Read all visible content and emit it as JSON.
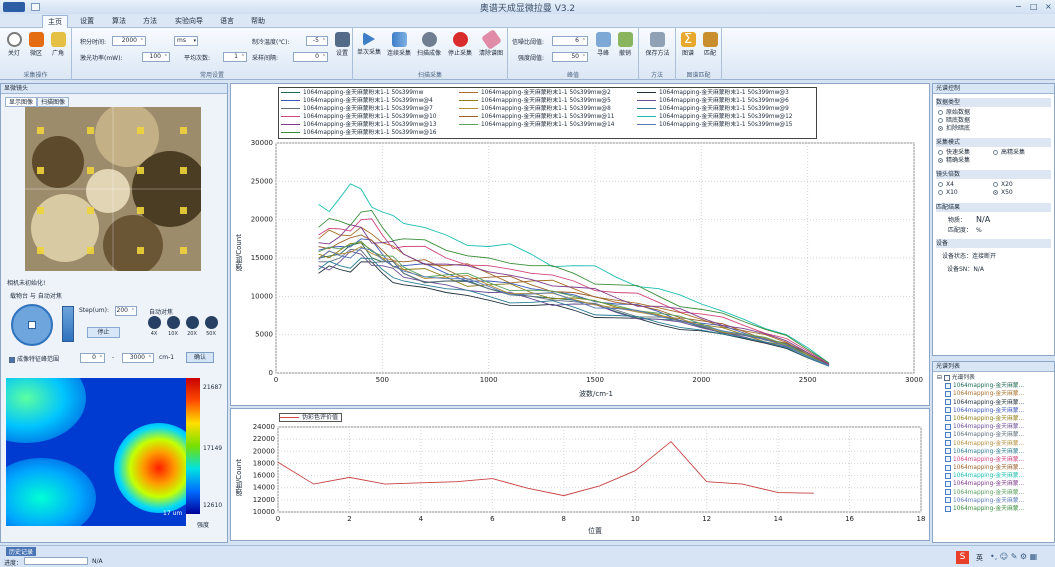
{
  "app": {
    "title": "奥谱天成显微拉曼 V3.2",
    "menu": [
      "主页",
      "设置",
      "算法",
      "方法",
      "实验向导",
      "语言",
      "帮助"
    ],
    "active_menu": "主页",
    "window_controls": [
      "−",
      "□",
      "×"
    ]
  },
  "ribbon": {
    "collect_group": {
      "title": "采集操作",
      "buttons": [
        "关灯",
        "微区",
        "广角"
      ]
    },
    "settings_group": {
      "title": "常用设置",
      "fields": [
        {
          "label": "积分时间:",
          "value": "2000",
          "unit": "ms"
        },
        {
          "label": "激光功率(mW):",
          "value": "100"
        },
        {
          "label": "平均次数:",
          "value": "1"
        },
        {
          "label": "制冷温度(℃):",
          "value": "-5"
        },
        {
          "label": "采样间隔:",
          "value": "0"
        }
      ],
      "button": "设置"
    },
    "scan_group": {
      "title": "扫描采集",
      "buttons": [
        "单次采集",
        "连续采集",
        "扫描成像",
        "停止采集",
        "清除谱图"
      ]
    },
    "peak_group": {
      "title": "峰值",
      "fields": [
        {
          "label": "信噪比阈值:",
          "value": "6"
        },
        {
          "label": "强度阈值:",
          "value": "50"
        }
      ],
      "buttons": [
        "寻峰",
        "撤销"
      ]
    },
    "method_group": {
      "title": "方法",
      "buttons": [
        "保存方法"
      ]
    },
    "match_group": {
      "title": "图谱匹配",
      "buttons": [
        "图谱",
        "匹配"
      ]
    }
  },
  "left_panel": {
    "title": "显微镜头",
    "tabs": [
      "显示图像",
      "扫描图像"
    ],
    "active_tab": "显示图像",
    "camera_status": "相机未初始化!",
    "stage_title": "载物台 与 自动对焦",
    "step_label": "Step(um):",
    "step_value": "200",
    "autofocus_label": "自动对焦",
    "stop_button": "停止",
    "objectives": [
      "4X",
      "10X",
      "20X",
      "50X"
    ],
    "range_checkbox": "成像特征峰范围",
    "range_from": "0",
    "range_to": "3000",
    "range_unit": "cm-1",
    "confirm": "确认",
    "colorbar": {
      "max": "21687",
      "mid": "17149",
      "min": "12610",
      "label": "强度"
    },
    "scale": "17 um"
  },
  "spectrum_chart": {
    "ylabel": "强度/Count",
    "xlabel": "波数/cm-1",
    "x_ticks": [
      "0",
      "500",
      "1000",
      "1500",
      "2000",
      "2500",
      "3000"
    ],
    "y_ticks": [
      "0",
      "5000",
      "10000",
      "15000",
      "20000",
      "25000",
      "30000"
    ],
    "legend": [
      "1064mapping-金天麻蒙粉末1-1  50s399mw",
      "1064mapping-金天麻蒙粉末1-1  50s399mw@2",
      "1064mapping-金天麻蒙粉末1-1  50s399mw@3",
      "1064mapping-金天麻蒙粉末1-1  50s399mw@4",
      "1064mapping-金天麻蒙粉末1-1  50s399mw@5",
      "1064mapping-金天麻蒙粉末1-1  50s399mw@6",
      "1064mapping-金天麻蒙粉末1-1  50s399mw@7",
      "1064mapping-金天麻蒙粉末1-1  50s399mw@8",
      "1064mapping-金天麻蒙粉末1-1  50s399mw@9",
      "1064mapping-金天麻蒙粉末1-1  50s399mw@10",
      "1064mapping-金天麻蒙粉末1-1  50s399mw@11",
      "1064mapping-金天麻蒙粉末1-1  50s399mw@12",
      "1064mapping-金天麻蒙粉末1-1  50s399mw@13",
      "1064mapping-金天麻蒙粉末1-1  50s399mw@14",
      "1064mapping-金天麻蒙粉末1-1  50s399mw@15",
      "1064mapping-金天麻蒙粉末1-1  50s399mw@16"
    ],
    "colors": [
      "#1f6b54",
      "#a76f2b",
      "#22323d",
      "#3c59b8",
      "#8f7d1a",
      "#6b4f98",
      "#5e6c7c",
      "#b48e3a",
      "#2b7d94",
      "#d1467a",
      "#9b5e29",
      "#1dbdb1",
      "#7f3a8c",
      "#59a05a",
      "#567ab8",
      "#3b8d3a"
    ]
  },
  "evaluation_chart": {
    "legend": "伪彩色评价值",
    "ylabel": "强度/Count",
    "xlabel": "位置",
    "x_ticks": [
      "0",
      "2",
      "4",
      "6",
      "8",
      "10",
      "12",
      "14",
      "16",
      "18"
    ],
    "y_ticks": [
      "10000",
      "12000",
      "14000",
      "16000",
      "18000",
      "20000",
      "22000",
      "24000"
    ]
  },
  "chart_data": [
    {
      "type": "line",
      "title": "",
      "xlabel": "波数/cm-1",
      "ylabel": "强度/Count",
      "xlim": [
        0,
        3000
      ],
      "ylim": [
        0,
        30000
      ],
      "series": [
        {
          "name": "1064mapping-金天麻蒙粉末1-1  50s399mw",
          "x": [
            200,
            300,
            400,
            500,
            600,
            800,
            1000,
            1200,
            1400,
            1600,
            1800,
            2000,
            2200,
            2400,
            2600
          ],
          "y": [
            15000,
            15500,
            17000,
            14500,
            13000,
            12000,
            11000,
            10000,
            9500,
            8000,
            7000,
            6000,
            5000,
            3500,
            1000
          ]
        },
        {
          "name": "1064mapping-金天麻蒙粉末1-1  50s399mw@2",
          "x": [
            200,
            300,
            400,
            500,
            600,
            800,
            1000,
            1200,
            1400,
            1600,
            1800,
            2000,
            2200,
            2400,
            2600
          ],
          "y": [
            17500,
            18000,
            19000,
            17000,
            15500,
            14000,
            13000,
            12000,
            11000,
            9500,
            8500,
            7000,
            5500,
            4000,
            1100
          ]
        },
        {
          "name": "1064mapping-金天麻蒙粉末1-1  50s399mw@3",
          "x": [
            200,
            300,
            400,
            500,
            600,
            800,
            1000,
            1200,
            1400,
            1600,
            1800,
            2000,
            2200,
            2400,
            2600
          ],
          "y": [
            13000,
            13500,
            14500,
            13000,
            11500,
            10500,
            9500,
            8800,
            8200,
            7200,
            6300,
            5500,
            4500,
            3200,
            900
          ]
        },
        {
          "name": "1064mapping-金天麻蒙粉末1-1  50s399mw@4",
          "x": [
            200,
            300,
            400,
            500,
            600,
            800,
            1000,
            1200,
            1400,
            1600,
            1800,
            2000,
            2200,
            2400,
            2600
          ],
          "y": [
            16000,
            16500,
            17500,
            15500,
            14000,
            13000,
            12000,
            11000,
            10200,
            9000,
            8000,
            6500,
            5200,
            3800,
            1000
          ]
        },
        {
          "name": "1064mapping-金天麻蒙粉末1-1  50s399mw@5",
          "x": [
            200,
            300,
            400,
            500,
            600,
            800,
            1000,
            1200,
            1400,
            1600,
            1800,
            2000,
            2200,
            2400,
            2600
          ],
          "y": [
            15500,
            16000,
            17000,
            15000,
            13500,
            12500,
            11500,
            10500,
            9800,
            8600,
            7600,
            6300,
            5000,
            3600,
            1000
          ]
        },
        {
          "name": "1064mapping-金天麻蒙粉末1-1  50s399mw@6",
          "x": [
            200,
            300,
            400,
            500,
            600,
            800,
            1000,
            1200,
            1400,
            1600,
            1800,
            2000,
            2200,
            2400,
            2600
          ],
          "y": [
            14000,
            14500,
            15500,
            14000,
            12500,
            11500,
            10500,
            9700,
            9000,
            7900,
            7000,
            5900,
            4700,
            3400,
            900
          ]
        },
        {
          "name": "1064mapping-金天麻蒙粉末1-1  50s399mw@7",
          "x": [
            200,
            300,
            400,
            500,
            600,
            800,
            1000,
            1200,
            1400,
            1600,
            1800,
            2000,
            2200,
            2400,
            2600
          ],
          "y": [
            14500,
            15000,
            16000,
            14500,
            13000,
            12000,
            11000,
            10000,
            9300,
            8200,
            7300,
            6100,
            4900,
            3500,
            1000
          ]
        },
        {
          "name": "1064mapping-金天麻蒙粉末1-1  50s399mw@8",
          "x": [
            200,
            300,
            400,
            500,
            600,
            800,
            1000,
            1200,
            1400,
            1600,
            1800,
            2000,
            2200,
            2400,
            2600
          ],
          "y": [
            15000,
            15500,
            16500,
            15000,
            13500,
            12500,
            11500,
            10400,
            9600,
            8500,
            7500,
            6200,
            5000,
            3600,
            1000
          ]
        },
        {
          "name": "1064mapping-金天麻蒙粉末1-1  50s399mw@9",
          "x": [
            200,
            300,
            400,
            500,
            600,
            800,
            1000,
            1200,
            1400,
            1600,
            1800,
            2000,
            2200,
            2400,
            2600
          ],
          "y": [
            13500,
            14000,
            15000,
            13500,
            12000,
            11000,
            10000,
            9200,
            8600,
            7500,
            6600,
            5600,
            4600,
            3300,
            900
          ]
        },
        {
          "name": "1064mapping-金天麻蒙粉末1-1  50s399mw@10",
          "x": [
            200,
            300,
            400,
            500,
            600,
            800,
            1000,
            1200,
            1400,
            1600,
            1800,
            2000,
            2200,
            2400,
            2600
          ],
          "y": [
            18000,
            18800,
            20000,
            18000,
            16500,
            15000,
            14000,
            13000,
            12000,
            10500,
            9200,
            7700,
            6200,
            4500,
            1200
          ]
        },
        {
          "name": "1064mapping-金天麻蒙粉末1-1  50s399mw@11",
          "x": [
            200,
            300,
            400,
            500,
            600,
            800,
            1000,
            1200,
            1400,
            1600,
            1800,
            2000,
            2200,
            2400,
            2600
          ],
          "y": [
            16500,
            17000,
            18000,
            16000,
            14500,
            13500,
            12500,
            11500,
            10500,
            9200,
            8200,
            6800,
            5400,
            3900,
            1100
          ]
        },
        {
          "name": "1064mapping-金天麻蒙粉末1-1  50s399mw@12",
          "x": [
            200,
            300,
            400,
            500,
            600,
            800,
            1000,
            1200,
            1400,
            1600,
            1800,
            2000,
            2200,
            2400,
            2600
          ],
          "y": [
            22000,
            22800,
            24000,
            21000,
            19500,
            18000,
            16500,
            15500,
            14000,
            12500,
            11000,
            9000,
            7000,
            5000,
            1300
          ]
        },
        {
          "name": "1064mapping-金天麻蒙粉末1-1  50s399mw@13",
          "x": [
            200,
            300,
            400,
            500,
            600,
            800,
            1000,
            1200,
            1400,
            1600,
            1800,
            2000,
            2200,
            2400,
            2600
          ],
          "y": [
            17000,
            17800,
            19000,
            17000,
            15500,
            14200,
            13200,
            12200,
            11200,
            9800,
            8700,
            7200,
            5800,
            4200,
            1100
          ]
        },
        {
          "name": "1064mapping-金天麻蒙粉末1-1  50s399mw@14",
          "x": [
            200,
            300,
            400,
            500,
            600,
            800,
            1000,
            1200,
            1400,
            1600,
            1800,
            2000,
            2200,
            2400,
            2600
          ],
          "y": [
            15800,
            16200,
            17200,
            15300,
            13800,
            12800,
            11800,
            10800,
            10000,
            8800,
            7800,
            6400,
            5100,
            3700,
            1000
          ]
        },
        {
          "name": "1064mapping-金天麻蒙粉末1-1  50s399mw@15",
          "x": [
            200,
            300,
            400,
            500,
            600,
            800,
            1000,
            1200,
            1400,
            1600,
            1800,
            2000,
            2200,
            2400,
            2600
          ],
          "y": [
            14800,
            15300,
            16300,
            14800,
            13300,
            12300,
            11300,
            10300,
            9500,
            8400,
            7400,
            6200,
            5000,
            3500,
            1000
          ]
        },
        {
          "name": "1064mapping-金天麻蒙粉末1-1  50s399mw@16",
          "x": [
            200,
            300,
            400,
            500,
            600,
            800,
            1000,
            1200,
            1400,
            1600,
            1800,
            2000,
            2200,
            2400,
            2600
          ],
          "y": [
            19000,
            19800,
            21000,
            19000,
            17500,
            16000,
            15000,
            14000,
            13000,
            11500,
            10000,
            8300,
            6700,
            4900,
            1300
          ]
        }
      ]
    },
    {
      "type": "line",
      "title": "",
      "xlabel": "位置",
      "ylabel": "强度/Count",
      "xlim": [
        0,
        18
      ],
      "ylim": [
        10000,
        24000
      ],
      "series": [
        {
          "name": "伪彩色评价值",
          "x": [
            0,
            1,
            2,
            3,
            4,
            5,
            6,
            7,
            8,
            9,
            10,
            11,
            12,
            13,
            14,
            15
          ],
          "y": [
            18200,
            14600,
            15700,
            14600,
            14800,
            15000,
            15500,
            13900,
            12700,
            14300,
            16800,
            21600,
            15000,
            14600,
            13200,
            13100
          ]
        }
      ]
    }
  ],
  "right_panel": {
    "title": "光谱控制",
    "data_type": {
      "title": "数据类型",
      "options": [
        "原始数据",
        "暗底数据",
        "扣除暗底"
      ],
      "selected": "扣除暗底"
    },
    "collect_mode": {
      "title": "采集模式",
      "options": [
        "快速采集",
        "高精采集",
        "精确采集"
      ],
      "selected": "精确采集"
    },
    "lens": {
      "title": "镜头倍数",
      "options": [
        "X4",
        "X20",
        "X10",
        "X50"
      ],
      "selected": "X50"
    },
    "match_result": {
      "title": "匹配结果",
      "substance_label": "物质：",
      "substance": "N/A",
      "degree_label": "匹配度：",
      "degree": "%"
    },
    "device": {
      "title": "设备",
      "status_label": "设备状态：",
      "status": "连接断开",
      "sn_label": "设备SN：",
      "sn": "N/A"
    },
    "list_title": "光谱列表",
    "list_root": "光谱列表",
    "list_items": [
      "1064mapping-金天麻蒙...",
      "1064mapping-金天麻蒙...",
      "1064mapping-金天麻蒙...",
      "1064mapping-金天麻蒙...",
      "1064mapping-金天麻蒙...",
      "1064mapping-金天麻蒙...",
      "1064mapping-金天麻蒙...",
      "1064mapping-金天麻蒙...",
      "1064mapping-金天麻蒙...",
      "1064mapping-金天麻蒙...",
      "1064mapping-金天麻蒙...",
      "1064mapping-金天麻蒙...",
      "1064mapping-金天麻蒙...",
      "1064mapping-金天麻蒙...",
      "1064mapping-金天麻蒙...",
      "1064mapping-金天麻蒙..."
    ]
  },
  "status_bar": {
    "history": "历史记录",
    "progress_label": "进度：",
    "progress_value": "N/A",
    "ime": "英"
  }
}
